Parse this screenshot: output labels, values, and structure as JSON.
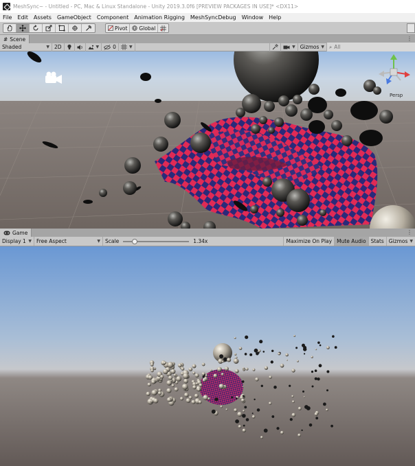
{
  "window": {
    "title": "MeshSync~ - Untitled - PC, Mac & Linux Standalone - Unity 2019.3.0f6 [PREVIEW PACKAGES IN USE]* <DX11>"
  },
  "menu": [
    "File",
    "Edit",
    "Assets",
    "GameObject",
    "Component",
    "Animation Rigging",
    "MeshSyncDebug",
    "Window",
    "Help"
  ],
  "toolbar": {
    "tools": [
      "hand-tool",
      "move-tool",
      "rotate-tool",
      "scale-tool",
      "rect-tool",
      "transform-tool",
      "custom-tool"
    ],
    "active_tool": "move-tool",
    "pivot_label": "Pivot",
    "global_label": "Global"
  },
  "scene_panel": {
    "tab_label": "Scene",
    "shading_mode": "Shaded",
    "mode_2d": "2D",
    "effects_count": "0",
    "gizmos_label": "Gizmos",
    "search_placeholder": "All",
    "orientation_label": "Persp"
  },
  "game_panel": {
    "tab_label": "Game",
    "display": "Display 1",
    "aspect": "Free Aspect",
    "scale_label": "Scale",
    "scale_value": "1.34x",
    "scale_fraction": 0.15,
    "maximize_label": "Maximize On Play",
    "mute_label": "Mute Audio",
    "stats_label": "Stats",
    "gizmos_label": "Gizmos"
  },
  "colors": {
    "checker_a": "#e02a55",
    "checker_b": "#2a2a7a",
    "sky_top": "#6f9ed8",
    "ground": "#7a716c"
  }
}
